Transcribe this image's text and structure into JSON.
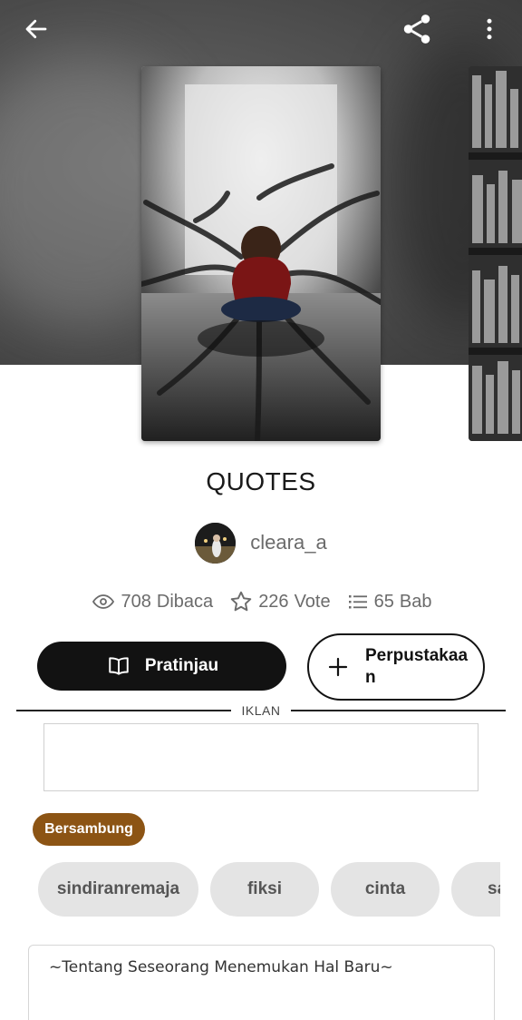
{
  "header": {
    "back_icon": "arrow-left-icon",
    "share_icon": "share-icon",
    "more_icon": "more-vertical-icon"
  },
  "story": {
    "title": "QUOTES",
    "author": "cleara_a",
    "stats": {
      "reads_value": "708",
      "reads_label": "Dibaca",
      "votes_value": "226",
      "votes_label": "Vote",
      "chapters_value": "65",
      "chapters_label": "Bab"
    },
    "status": "Bersambung",
    "description": "~Tentang Seseorang Menemukan Hal Baru~"
  },
  "actions": {
    "preview_label": "Pratinjau",
    "library_label": "Perpustakaan"
  },
  "ad": {
    "label": "IKLAN"
  },
  "tags": [
    "sindiranremaja",
    "fiksi",
    "cinta",
    "sa"
  ],
  "colors": {
    "status_badge": "#8c5414",
    "primary_button": "#121212",
    "tag_bg": "#e4e4e4"
  }
}
